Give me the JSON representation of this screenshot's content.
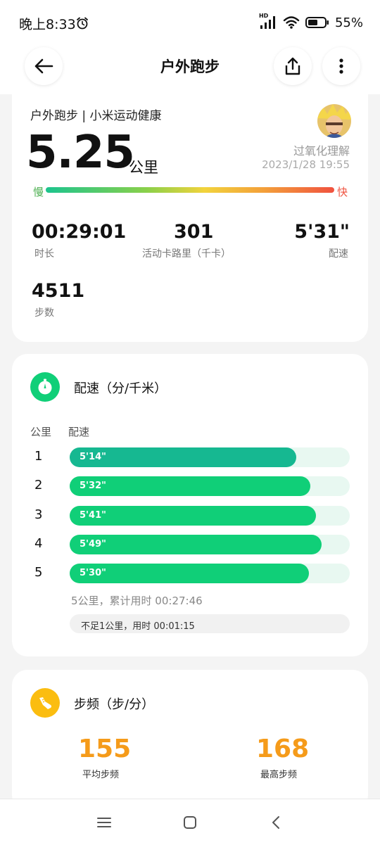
{
  "status_bar": {
    "time": "晚上8:33",
    "network": "HD",
    "battery": "55%"
  },
  "header": {
    "title": "户外跑步"
  },
  "summary": {
    "source": "户外跑步 | 小米运动健康",
    "user_name": "过氧化理解",
    "datetime": "2023/1/28 19:55",
    "distance": "5.25",
    "distance_unit": "公里",
    "slow_label": "慢",
    "fast_label": "快",
    "stats": [
      {
        "value": "00:29:01",
        "label": "时长"
      },
      {
        "value": "301",
        "label": "活动卡路里（千卡）"
      },
      {
        "value": "5'31\"",
        "label": "配速"
      },
      {
        "value": "4511",
        "label": "步数"
      }
    ]
  },
  "pace": {
    "title": "配速（分/千米）",
    "col_km": "公里",
    "col_pace": "配速",
    "rows": [
      {
        "km": "1",
        "pace": "5'14\"",
        "fraction": 0.81
      },
      {
        "km": "2",
        "pace": "5'32\"",
        "fraction": 0.86
      },
      {
        "km": "3",
        "pace": "5'41\"",
        "fraction": 0.88
      },
      {
        "km": "4",
        "pace": "5'49\"",
        "fraction": 0.9
      },
      {
        "km": "5",
        "pace": "5'30\"",
        "fraction": 0.855
      }
    ],
    "summary": "5公里，累计用时 00:27:46",
    "partial": "不足1公里，用时 00:01:15"
  },
  "cadence": {
    "title": "步频（步/分）",
    "avg_value": "155",
    "avg_label": "平均步频",
    "max_value": "168",
    "max_label": "最高步频"
  },
  "colors": {
    "accent_green": "#10cf78",
    "fastest_green": "#16b891",
    "cadence_orange": "#f59b1a",
    "cadence_icon": "#fbbd10"
  },
  "icons": {
    "back": "arrow-left-icon",
    "share": "share-icon",
    "more": "more-vertical-icon",
    "pace": "stopwatch-icon",
    "cadence": "shoe-icon"
  }
}
